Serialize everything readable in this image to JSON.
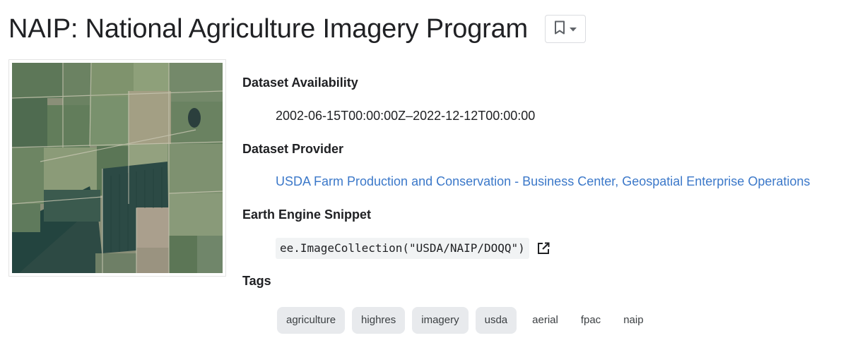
{
  "page": {
    "title": "NAIP: National Agriculture Imagery Program"
  },
  "details": {
    "availability": {
      "label": "Dataset Availability",
      "value": "2002-06-15T00:00:00Z–2022-12-12T00:00:00"
    },
    "provider": {
      "label": "Dataset Provider",
      "value": "USDA Farm Production and Conservation - Business Center, Geospatial Enterprise Operations"
    },
    "snippet": {
      "label": "Earth Engine Snippet",
      "code": "ee.ImageCollection(\"USDA/NAIP/DOQQ\")"
    },
    "tags": {
      "label": "Tags",
      "items": [
        {
          "label": "agriculture",
          "style": "filled"
        },
        {
          "label": "highres",
          "style": "filled"
        },
        {
          "label": "imagery",
          "style": "filled"
        },
        {
          "label": "usda",
          "style": "filled"
        },
        {
          "label": "aerial",
          "style": "plain"
        },
        {
          "label": "fpac",
          "style": "plain"
        },
        {
          "label": "naip",
          "style": "plain"
        }
      ]
    }
  },
  "icons": {
    "bookmark": "bookmark-icon",
    "dropdown": "arrow-drop-down-icon",
    "open": "open-in-new-icon"
  }
}
